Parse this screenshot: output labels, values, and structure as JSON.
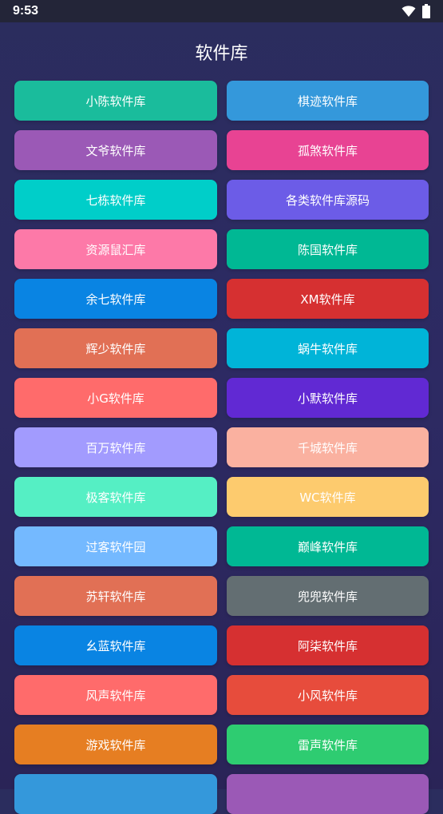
{
  "status_bar": {
    "time": "9:53"
  },
  "title": "软件库",
  "buttons": [
    {
      "label": "小陈软件库",
      "color": "#1abc9c"
    },
    {
      "label": "棋迹软件库",
      "color": "#3498db"
    },
    {
      "label": "文爷软件库",
      "color": "#9b59b6"
    },
    {
      "label": "孤煞软件库",
      "color": "#e84393"
    },
    {
      "label": "七栋软件库",
      "color": "#00cec9"
    },
    {
      "label": "各类软件库源码",
      "color": "#6c5ce7"
    },
    {
      "label": "资源鼠汇库",
      "color": "#fd79a8"
    },
    {
      "label": "陈国软件库",
      "color": "#00b894"
    },
    {
      "label": "余七软件库",
      "color": "#0984e3"
    },
    {
      "label": "XM软件库",
      "color": "#d63031"
    },
    {
      "label": "辉少软件库",
      "color": "#e17055"
    },
    {
      "label": "蜗牛软件库",
      "color": "#00b4d8"
    },
    {
      "label": "小G软件库",
      "color": "#ff6b6b"
    },
    {
      "label": "小默软件库",
      "color": "#6129d3"
    },
    {
      "label": "百万软件库",
      "color": "#a29bfe"
    },
    {
      "label": "千城软件库",
      "color": "#fab1a0"
    },
    {
      "label": "极客软件库",
      "color": "#55efc4"
    },
    {
      "label": "WC软件库",
      "color": "#fdcb6e"
    },
    {
      "label": "过客软件园",
      "color": "#74b9ff"
    },
    {
      "label": "巅峰软件库",
      "color": "#00b894"
    },
    {
      "label": "苏轩软件库",
      "color": "#e17055"
    },
    {
      "label": "兜兜软件库",
      "color": "#636e72"
    },
    {
      "label": "幺蓝软件库",
      "color": "#0984e3"
    },
    {
      "label": "阿柒软件库",
      "color": "#d63031"
    },
    {
      "label": "风声软件库",
      "color": "#ff6b6b"
    },
    {
      "label": "小风软件库",
      "color": "#e74c3c"
    },
    {
      "label": "游戏软件库",
      "color": "#e67e22"
    },
    {
      "label": "雷声软件库",
      "color": "#2ecc71"
    },
    {
      "label": "",
      "color": "#3498db"
    },
    {
      "label": "",
      "color": "#9b59b6"
    }
  ]
}
